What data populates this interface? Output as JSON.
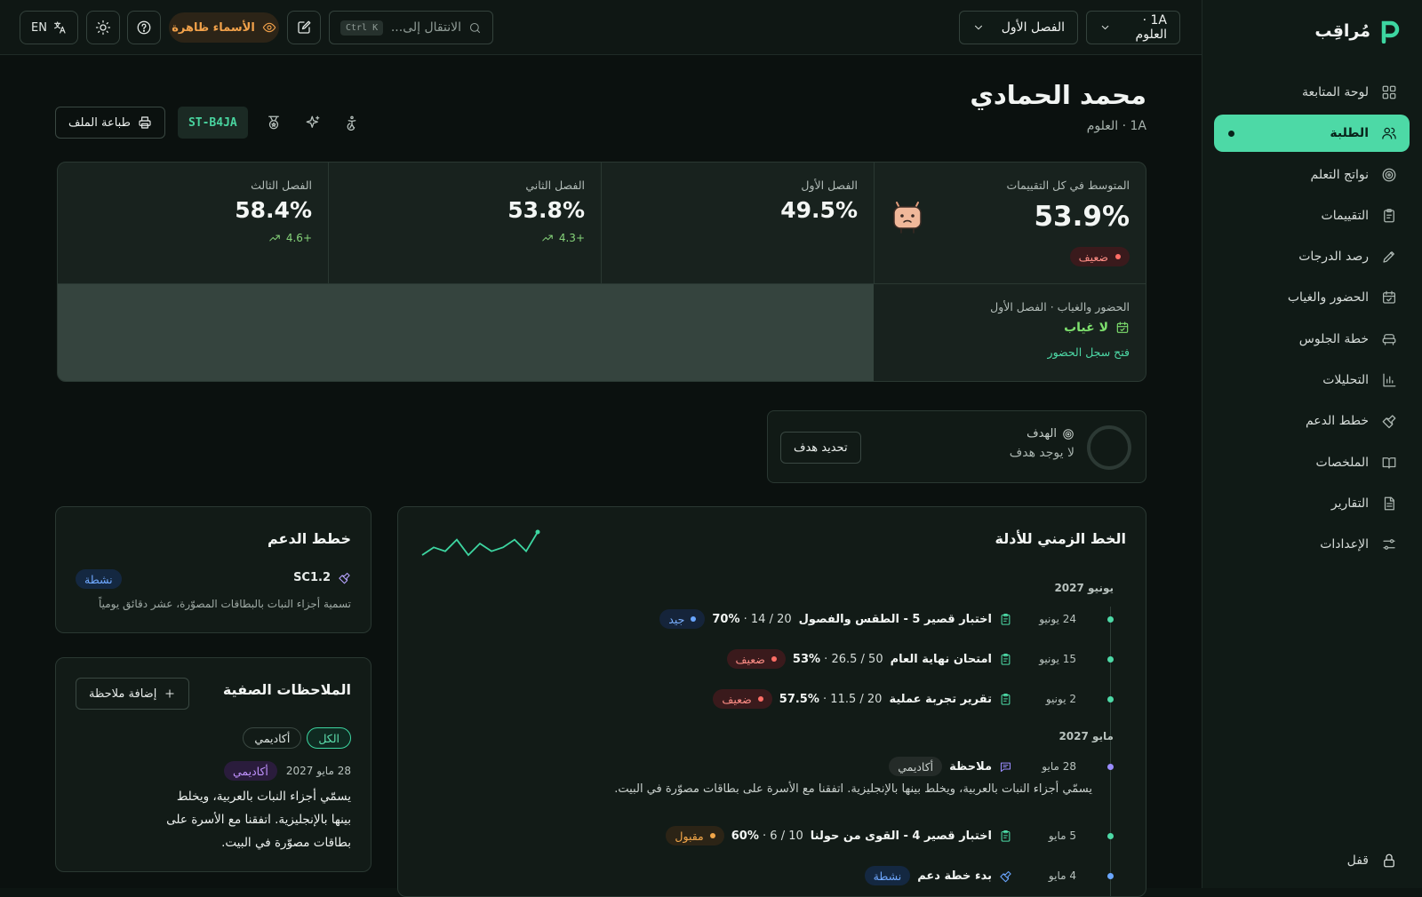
{
  "brand": {
    "name": "مُراقِب"
  },
  "sidebar": {
    "items": [
      {
        "label": "لوحة المتابعة",
        "icon": "dashboard-icon"
      },
      {
        "label": "الطلبة",
        "icon": "users-icon"
      },
      {
        "label": "نواتج التعلم",
        "icon": "target-icon"
      },
      {
        "label": "التقييمات",
        "icon": "clipboard-icon"
      },
      {
        "label": "رصد الدرجات",
        "icon": "pencil-icon"
      },
      {
        "label": "الحضور والغياب",
        "icon": "calendar-icon"
      },
      {
        "label": "خطة الجلوس",
        "icon": "seat-icon"
      },
      {
        "label": "التحليلات",
        "icon": "bar-chart-icon"
      },
      {
        "label": "خطط الدعم",
        "icon": "support-icon"
      },
      {
        "label": "الملخصات",
        "icon": "book-icon"
      },
      {
        "label": "التقارير",
        "icon": "report-icon"
      },
      {
        "label": "الإعدادات",
        "icon": "sliders-icon"
      }
    ],
    "lock_label": "قفل"
  },
  "topbar": {
    "class_select": "1A · العلوم",
    "term_select": "الفصل الأول",
    "search_placeholder": "الانتقال إلى...",
    "search_shortcut": "Ctrl K",
    "names_toggle": "الأسماء ظاهرة",
    "language": "EN"
  },
  "student": {
    "name": "محمد الحمادي",
    "class_label": "1A · العلوم",
    "id": "ST-B4JA",
    "print_label": "طباعة الملف"
  },
  "stats": {
    "overall_label": "المتوسط في كل التقييمات",
    "overall_value": "53.9%",
    "overall_badge": "ضعيف",
    "term1_label": "الفصل الأول",
    "term1_value": "49.5%",
    "term2_label": "الفصل الثاني",
    "term2_value": "53.8%",
    "term2_delta": "+4.3",
    "term3_label": "الفصل الثالث",
    "term3_value": "58.4%",
    "term3_delta": "+4.6",
    "attendance_label": "الحضور والغياب · الفصل الأول",
    "attendance_value": "لا غياب",
    "attendance_link": "فتح سجل الحضور"
  },
  "goal": {
    "label": "الهدف",
    "value": "لا يوجد هدف",
    "button": "تحديد هدف"
  },
  "timeline": {
    "title": "الخط الزمني للأدلة",
    "groups": [
      {
        "month": "يونيو 2027",
        "entries": [
          {
            "date": "24 يونيو",
            "title": "اختبار قصير 5 - الطقس والفصول",
            "score": "20 / 14 · ",
            "pct": "70%",
            "badge": "جيد",
            "kind": "good"
          },
          {
            "date": "15 يونيو",
            "title": "امتحان نهاية العام",
            "score": "50 / 26.5 · ",
            "pct": "53%",
            "badge": "ضعيف",
            "kind": "weak"
          },
          {
            "date": "2 يونيو",
            "title": "تقرير تجربة عملية",
            "score": "20 / 11.5 · ",
            "pct": "57.5%",
            "badge": "ضعيف",
            "kind": "weak"
          }
        ]
      },
      {
        "month": "مايو 2027",
        "note": {
          "date": "28 مايو",
          "title": "ملاحظة",
          "tag": "أكاديمي",
          "text": "يسمّي أجزاء النبات بالعربية، ويخلط بينها بالإنجليزية. اتفقنا مع الأسرة على بطاقات مصوّرة في البيت."
        },
        "entries": [
          {
            "date": "5 مايو",
            "title": "اختبار قصير 4 - القوى من حولنا",
            "score": "10 / 6 · ",
            "pct": "60%",
            "badge": "مقبول",
            "kind": "ok"
          },
          {
            "date": "4 مايو",
            "title": "بدء خطة دعم",
            "score": "",
            "pct": "",
            "badge": "نشطة",
            "kind": "active"
          }
        ]
      }
    ],
    "sparkline": [
      2,
      4,
      3,
      6,
      2,
      5,
      3,
      4,
      6,
      3,
      8
    ]
  },
  "support": {
    "title": "خطط الدعم",
    "plan_code": "SC1.2",
    "plan_status": "نشطة",
    "plan_desc": "تسمية أجزاء النبات بالبطاقات المصوّرة، عشر دقائق يومياً"
  },
  "notes": {
    "title": "الملاحظات الصفية",
    "add_button": "إضافة ملاحظة",
    "filters": [
      "الكل",
      "أكاديمي"
    ],
    "note_date": "28 مايو 2027",
    "note_tag": "أكاديمي",
    "note_text": "يسمّي أجزاء النبات بالعربية، ويخلط بينها بالإنجليزية. اتفقنا مع الأسرة على بطاقات مصوّرة في البيت."
  },
  "colors": {
    "accent": "#4dd9a6",
    "weak": "#ff6e66",
    "good": "#6aa6ff",
    "ok": "#f2a649"
  }
}
